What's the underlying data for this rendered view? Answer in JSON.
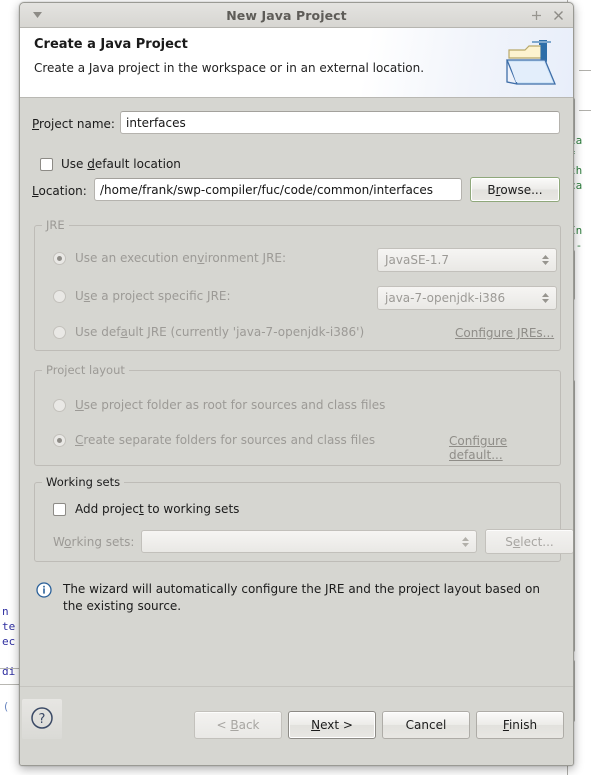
{
  "window": {
    "title": "New Java Project",
    "menu_icon": "chevron-down-icon",
    "maximize_icon": "maximize-icon",
    "close_icon": "close-icon"
  },
  "banner": {
    "title": "Create a Java Project",
    "subtitle": "Create a Java project in the workspace or in an external location.",
    "icon": "new-java-project-folder-icon"
  },
  "form": {
    "project_name_label": "Project name:",
    "project_name_value": "interfaces",
    "project_name_placeholder": "",
    "use_default_location_label": "Use default location",
    "use_default_location_checked": false,
    "location_label": "Location:",
    "location_value": "/home/frank/swp-compiler/fuc/code/common/interfaces",
    "location_placeholder": "",
    "browse_button": "Browse..."
  },
  "jre": {
    "group_label": "JRE",
    "enabled": false,
    "options": [
      {
        "label": "Use an execution environment JRE:",
        "selected": true,
        "combo_value": "JavaSE-1.7",
        "has_combo": true
      },
      {
        "label": "Use a project specific JRE:",
        "selected": false,
        "combo_value": "java-7-openjdk-i386",
        "has_combo": true
      },
      {
        "label": "Use default JRE (currently 'java-7-openjdk-i386')",
        "selected": false,
        "combo_value": "",
        "has_combo": false
      }
    ],
    "configure_link": "Configure JREs..."
  },
  "project_layout": {
    "group_label": "Project layout",
    "enabled": false,
    "options": [
      {
        "label": "Use project folder as root for sources and class files",
        "selected": false
      },
      {
        "label": "Create separate folders for sources and class files",
        "selected": true
      }
    ],
    "configure_link": "Configure default..."
  },
  "working_sets": {
    "group_label": "Working sets",
    "add_checkbox_label": "Add project to working sets",
    "add_checkbox_checked": false,
    "combo_label": "Working sets:",
    "combo_value": "",
    "select_button": "Select...",
    "enabled": false
  },
  "info": {
    "icon": "info-icon",
    "line1": "The wizard will automatically configure the JRE and the project layout based on",
    "line2": "the existing source."
  },
  "footer": {
    "help_icon": "help-question-icon",
    "buttons": [
      {
        "label": "< Back",
        "state": "disabled"
      },
      {
        "label": "Next >",
        "state": "default"
      },
      {
        "label": "Cancel",
        "state": "normal"
      },
      {
        "label": "Finish",
        "state": "normal"
      }
    ]
  },
  "background": {
    "left_code": "n\nte\nec\n\ndi",
    "right_code": "u\nca\nf\nth\nca\n\n\nIn\n -\n\n.",
    "colors": {
      "dialog_face": "#d6d6d1",
      "title_text": "#5e5c58",
      "accent_info": "#2a6099",
      "disabled_text": "#9c9a96"
    }
  }
}
